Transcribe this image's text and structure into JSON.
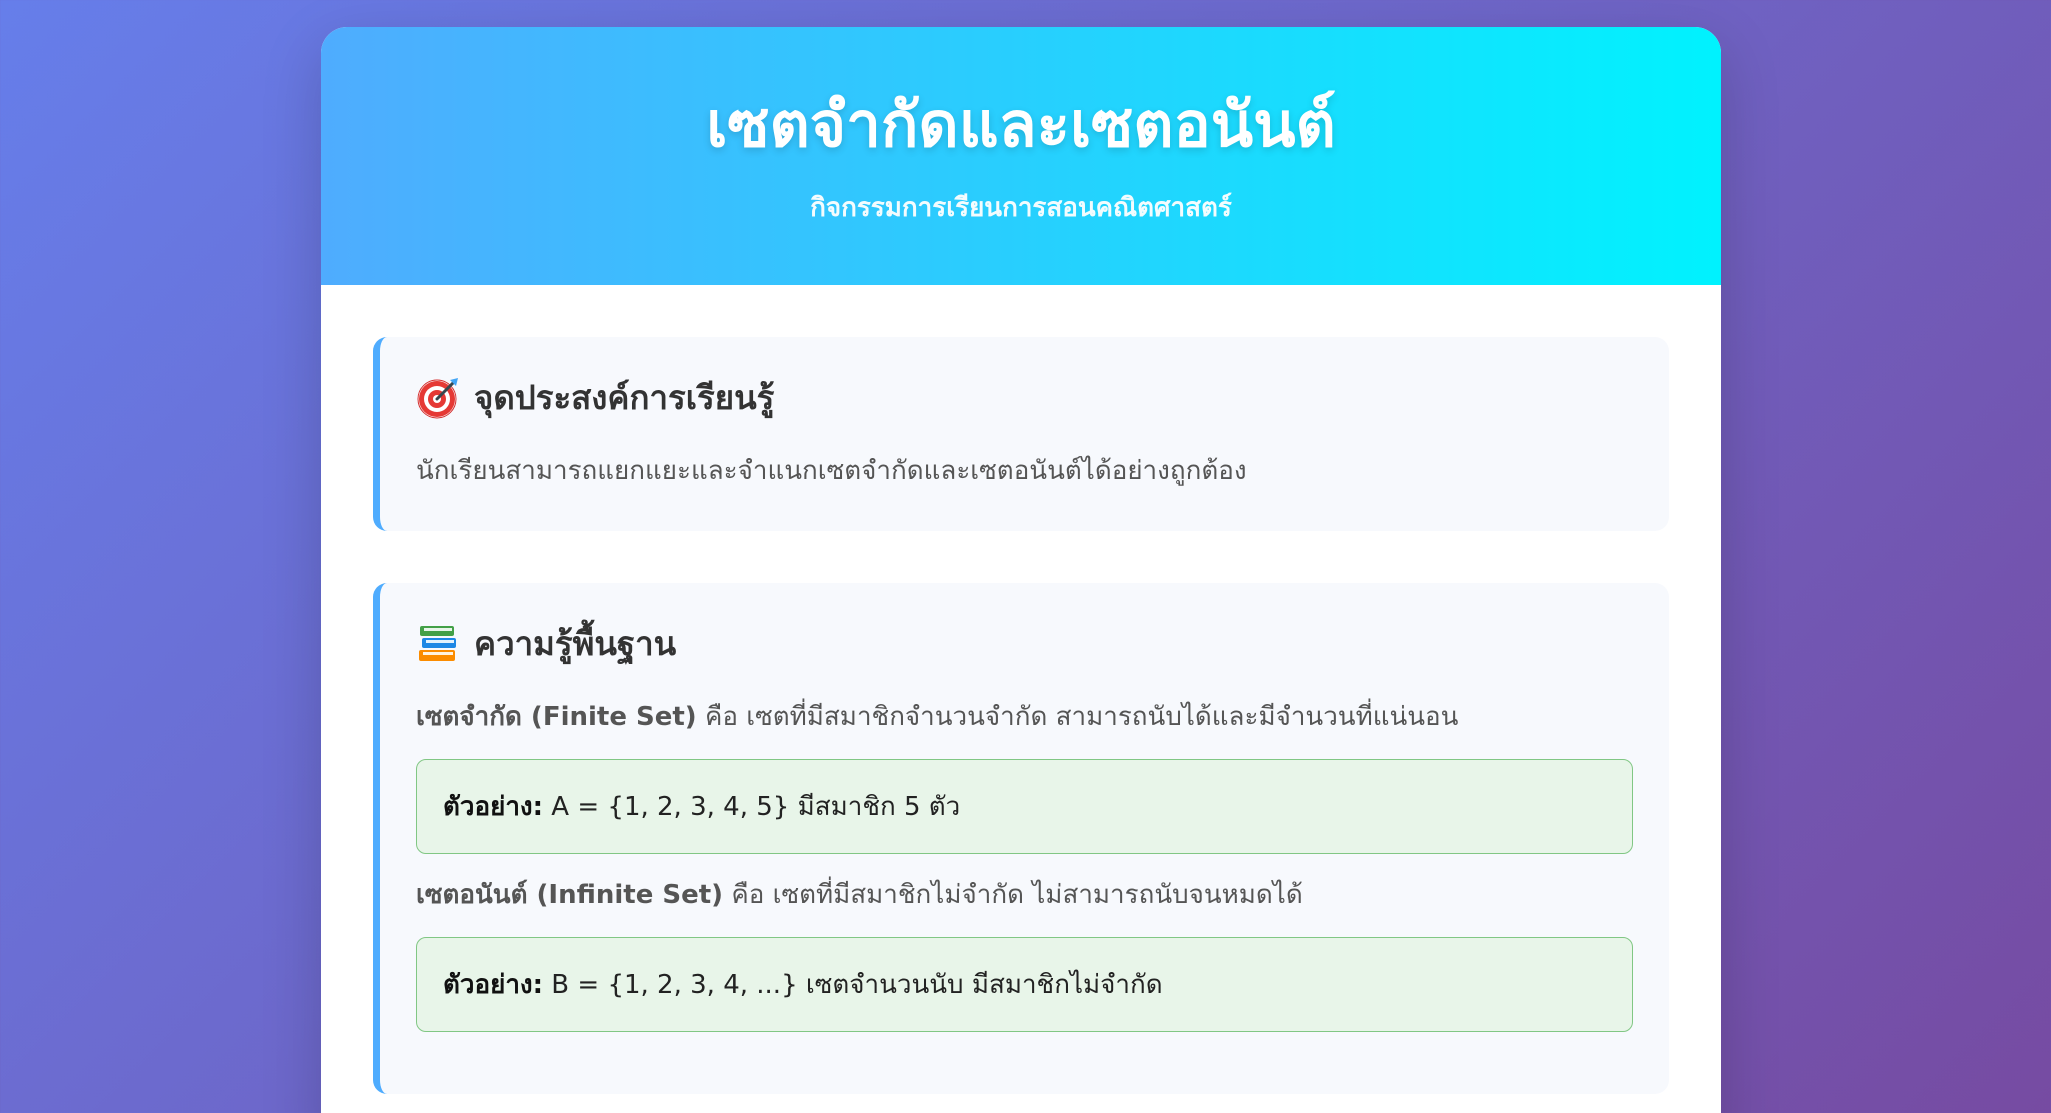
{
  "header": {
    "title": "เซตจำกัดและเซตอนันต์",
    "subtitle": "กิจกรรมการเรียนการสอนคณิตศาสตร์"
  },
  "objectives": {
    "icon": "target-icon",
    "heading": "จุดประสงค์การเรียนรู้",
    "text": "นักเรียนสามารถแยกแยะและจำแนกเซตจำกัดและเซตอนันต์ได้อย่างถูกต้อง"
  },
  "basics": {
    "icon": "books-icon",
    "heading": "ความรู้พื้นฐาน",
    "finite": {
      "term": "เซตจำกัด (Finite Set)",
      "definition": " คือ เซตที่มีสมาชิกจำนวนจำกัด สามารถนับได้และมีจำนวนที่แน่นอน",
      "example_label": "ตัวอย่าง:",
      "example_text": " A = {1, 2, 3, 4, 5} มีสมาชิก 5 ตัว"
    },
    "infinite": {
      "term": "เซตอนันต์ (Infinite Set)",
      "definition": " คือ เซตที่มีสมาชิกไม่จำกัด ไม่สามารถนับจนหมดได้",
      "example_label": "ตัวอย่าง:",
      "example_text": " B = {1, 2, 3, 4, ...} เซตจำนวนนับ มีสมาชิกไม่จำกัด"
    }
  },
  "colors": {
    "page_gradient_start": "#667eea",
    "page_gradient_end": "#764ba2",
    "header_gradient_start": "#4facfe",
    "header_gradient_end": "#00f2fe",
    "accent_border": "#4facfe",
    "example_bg": "#e8f5e9",
    "example_border": "#81c784"
  }
}
